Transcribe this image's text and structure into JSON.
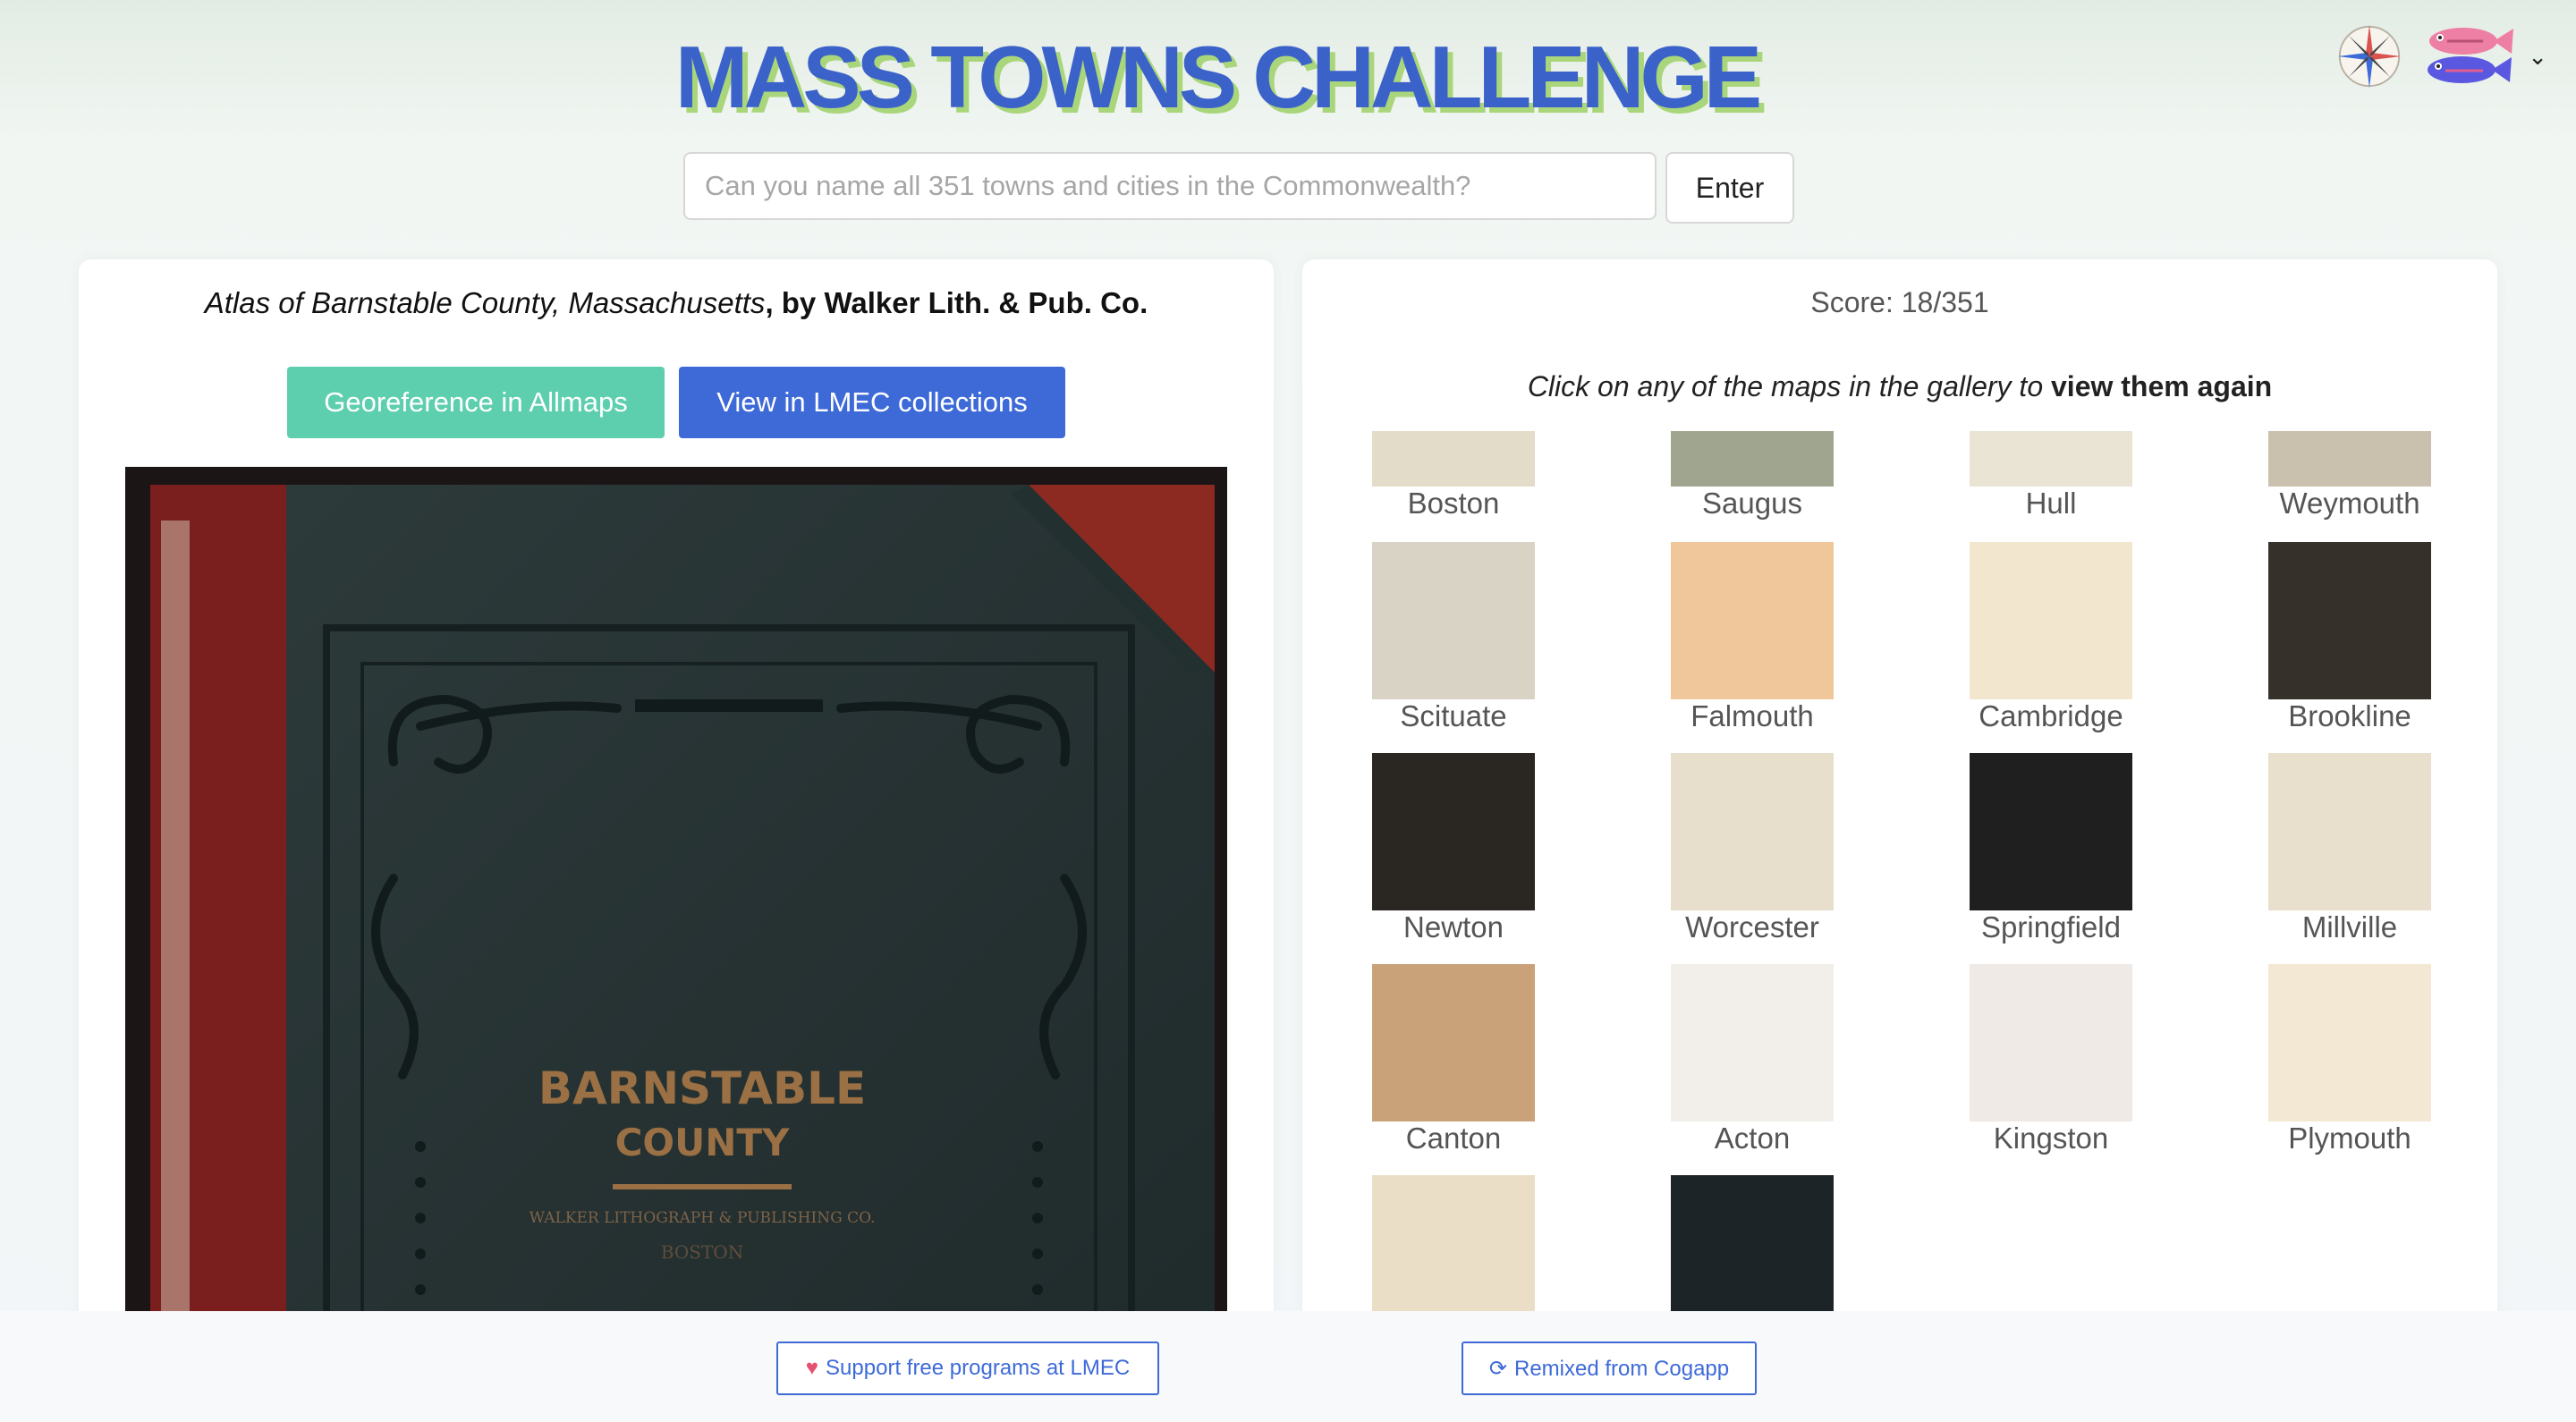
{
  "header": {
    "title": "MASS TOWNS CHALLENGE",
    "icons": [
      "compass-icon",
      "fish-logo-icon",
      "chevron-down-icon"
    ]
  },
  "search": {
    "placeholder": "Can you name all 351 towns and cities in the Commonwealth?",
    "value": "",
    "enter_label": "Enter"
  },
  "map_panel": {
    "atlas_title": "Atlas of Barnstable County, Massachusetts",
    "atlas_by": ", by Walker Lith. & Pub. Co.",
    "georeference_label": "Georeference in Allmaps",
    "view_label": "View in LMEC collections",
    "cover": {
      "line1": "BARNSTABLE",
      "line2": "COUNTY",
      "line3": "WALKER LITHOGRAPH & PUBLISHING CO.",
      "line4": "BOSTON"
    }
  },
  "gallery_panel": {
    "score": "Score: 18/351",
    "hint_prefix": "Click on any of the maps in the gallery to ",
    "hint_bold": "view them again",
    "items": [
      {
        "label": "Boston",
        "color": "#e3dcc8"
      },
      {
        "label": "Saugus",
        "color": "#9fa58f"
      },
      {
        "label": "Hull",
        "color": "#e9e4d4"
      },
      {
        "label": "Weymouth",
        "color": "#c9c1ad"
      },
      {
        "label": "Scituate",
        "color": "#d8d3c4"
      },
      {
        "label": "Falmouth",
        "color": "#f0c79a"
      },
      {
        "label": "Cambridge",
        "color": "#f3e6cf"
      },
      {
        "label": "Brookline",
        "color": "#36302a"
      },
      {
        "label": "Newton",
        "color": "#2a2622"
      },
      {
        "label": "Worcester",
        "color": "#e7dfcb"
      },
      {
        "label": "Springfield",
        "color": "#1f1f1f"
      },
      {
        "label": "Millville",
        "color": "#e8e0cd"
      },
      {
        "label": "Canton",
        "color": "#c9a27a"
      },
      {
        "label": "Acton",
        "color": "#f2efea"
      },
      {
        "label": "Kingston",
        "color": "#efeae5"
      },
      {
        "label": "Plymouth",
        "color": "#f3e8d3"
      },
      {
        "label": "",
        "color": "#eadfc6"
      },
      {
        "label": "",
        "color": "#1d2428"
      }
    ]
  },
  "footer": {
    "support_label": "Support free programs at LMEC",
    "remix_label": "Remixed from Cogapp"
  }
}
